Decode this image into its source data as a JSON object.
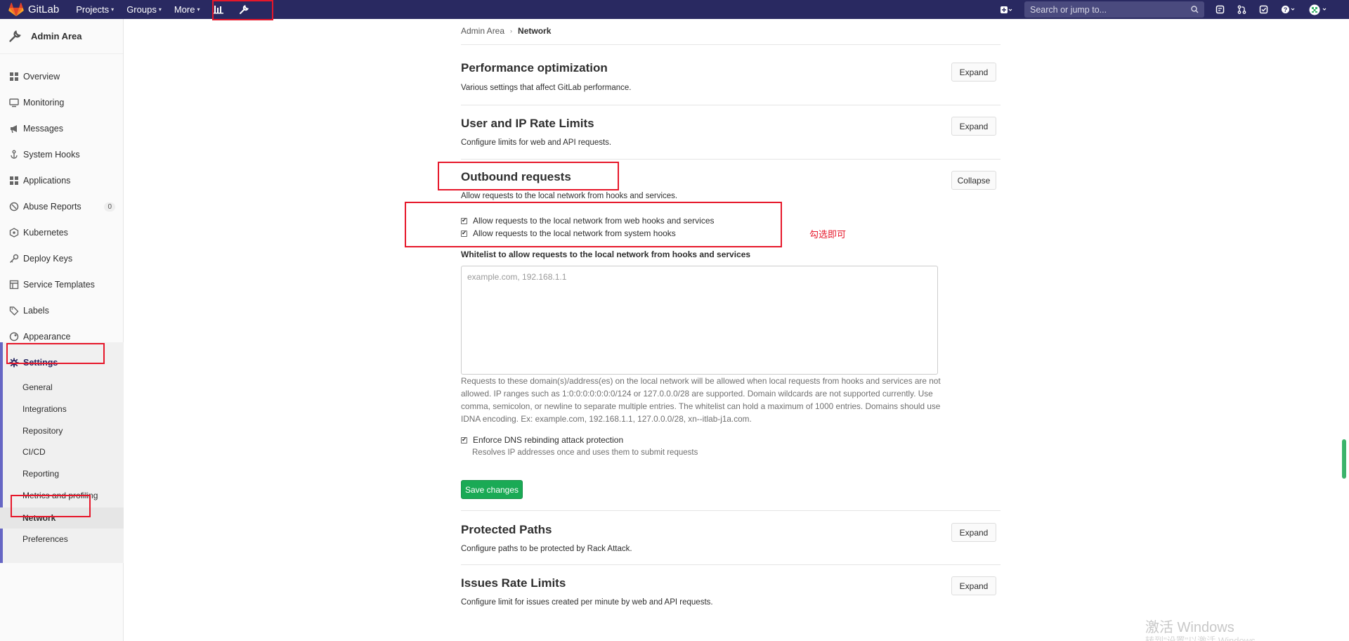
{
  "navbar": {
    "brand": "GitLab",
    "menu": [
      "Projects",
      "Groups",
      "More"
    ],
    "search_placeholder": "Search or jump to..."
  },
  "sidebar": {
    "title": "Admin Area",
    "items": [
      {
        "label": "Overview",
        "icon": "overview-icon"
      },
      {
        "label": "Monitoring",
        "icon": "monitor-icon"
      },
      {
        "label": "Messages",
        "icon": "bullhorn-icon"
      },
      {
        "label": "System Hooks",
        "icon": "hook-icon"
      },
      {
        "label": "Applications",
        "icon": "applications-icon"
      },
      {
        "label": "Abuse Reports",
        "icon": "abuse-icon",
        "badge": "0"
      },
      {
        "label": "Kubernetes",
        "icon": "kubernetes-icon"
      },
      {
        "label": "Deploy Keys",
        "icon": "key-icon"
      },
      {
        "label": "Service Templates",
        "icon": "template-icon"
      },
      {
        "label": "Labels",
        "icon": "label-icon"
      },
      {
        "label": "Appearance",
        "icon": "appearance-icon"
      },
      {
        "label": "Settings",
        "icon": "settings-icon"
      }
    ],
    "settings_sub": [
      "General",
      "Integrations",
      "Repository",
      "CI/CD",
      "Reporting",
      "Metrics and profiling",
      "Network",
      "Preferences"
    ]
  },
  "breadcrumb": {
    "root": "Admin Area",
    "current": "Network"
  },
  "sections": {
    "performance": {
      "title": "Performance optimization",
      "desc": "Various settings that affect GitLab performance.",
      "button": "Expand"
    },
    "rate_limits": {
      "title": "User and IP Rate Limits",
      "desc": "Configure limits for web and API requests.",
      "button": "Expand"
    },
    "outbound": {
      "title": "Outbound requests",
      "desc": "Allow requests to the local network from hooks and services.",
      "button": "Collapse",
      "checkbox1": "Allow requests to the local network from web hooks and services",
      "checkbox2": "Allow requests to the local network from system hooks",
      "whitelist_label": "Whitelist to allow requests to the local network from hooks and services",
      "whitelist_placeholder": "example.com, 192.168.1.1",
      "help": "Requests to these domain(s)/address(es) on the local network will be allowed when local requests from hooks and services are not allowed. IP ranges such as 1:0:0:0:0:0:0:0/124 or 127.0.0.0/28 are supported. Domain wildcards are not supported currently. Use comma, semicolon, or newline to separate multiple entries. The whitelist can hold a maximum of 1000 entries. Domains should use IDNA encoding. Ex: example.com, 192.168.1.1, 127.0.0.0/28, xn--itlab-j1a.com.",
      "dns_checkbox": "Enforce DNS rebinding attack protection",
      "dns_help": "Resolves IP addresses once and uses them to submit requests",
      "save": "Save changes"
    },
    "protected_paths": {
      "title": "Protected Paths",
      "desc": "Configure paths to be protected by Rack Attack.",
      "button": "Expand"
    },
    "issues_rate": {
      "title": "Issues Rate Limits",
      "desc": "Configure limit for issues created per minute by web and API requests.",
      "button": "Expand"
    }
  },
  "annotation": {
    "note": "勾选即可"
  },
  "watermark": {
    "line1": "激活 Windows",
    "line2": "转到\"设置\"以激活 Windows。"
  },
  "colors": {
    "navbar": "#292961",
    "save": "#1aaa55",
    "annotation": "#e6172a"
  }
}
